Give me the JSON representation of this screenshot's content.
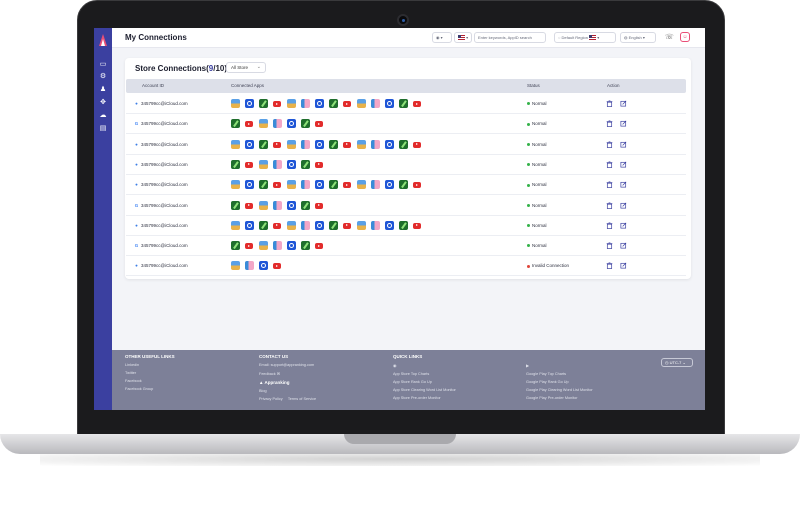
{
  "topbar": {
    "title": "My Connections",
    "search_placeholder": "Enter keywords, AppID search",
    "region": "Default Region",
    "language": "English"
  },
  "sidebar": {
    "icons": [
      "logo-icon",
      "monitor-icon",
      "gear-icon",
      "bell-icon",
      "network-icon",
      "cloud-icon",
      "briefcase-icon"
    ]
  },
  "card": {
    "title_prefix": "Store Connections",
    "title_open": "(",
    "count_used": "9",
    "count_sep": "/10",
    "title_close": ")",
    "store_filter": "All Store",
    "headers": {
      "account": "Account ID",
      "apps": "Connected Apps",
      "status": "Status",
      "action": "Action"
    }
  },
  "rows": [
    {
      "platform": "apple",
      "account": "345799cc@iCloud.com",
      "status": "Normal",
      "status_color": "#35b24a",
      "apps": [
        "sky",
        "circ",
        "grn",
        "yt",
        "sky",
        "bag",
        "circ",
        "grn",
        "yt",
        "sky",
        "bag",
        "circ",
        "grn",
        "yt"
      ]
    },
    {
      "platform": "google",
      "account": "345799cc@iCloud.com",
      "status": "Normal",
      "status_color": "#35b24a",
      "apps": [
        "grn",
        "yt",
        "sky",
        "bag",
        "circ",
        "grn",
        "yt"
      ]
    },
    {
      "platform": "apple",
      "account": "345799cc@iCloud.com",
      "status": "Normal",
      "status_color": "#35b24a",
      "apps": [
        "sky",
        "circ",
        "grn",
        "yt",
        "sky",
        "bag",
        "circ",
        "grn",
        "yt",
        "sky",
        "bag",
        "circ",
        "grn",
        "yt"
      ]
    },
    {
      "platform": "apple",
      "account": "345799cc@iCloud.com",
      "status": "Normal",
      "status_color": "#35b24a",
      "apps": [
        "grn",
        "yt",
        "sky",
        "bag",
        "circ",
        "grn",
        "yt"
      ]
    },
    {
      "platform": "apple",
      "account": "345799cc@iCloud.com",
      "status": "Normal",
      "status_color": "#35b24a",
      "apps": [
        "sky",
        "circ",
        "grn",
        "yt",
        "sky",
        "bag",
        "circ",
        "grn",
        "yt",
        "sky",
        "bag",
        "circ",
        "grn",
        "yt"
      ]
    },
    {
      "platform": "google",
      "account": "345799cc@iCloud.com",
      "status": "Normal",
      "status_color": "#35b24a",
      "apps": [
        "grn",
        "yt",
        "sky",
        "bag",
        "circ",
        "grn",
        "yt"
      ]
    },
    {
      "platform": "apple",
      "account": "345799cc@iCloud.com",
      "status": "Normal",
      "status_color": "#35b24a",
      "apps": [
        "sky",
        "circ",
        "grn",
        "yt",
        "sky",
        "bag",
        "circ",
        "grn",
        "yt",
        "sky",
        "bag",
        "circ",
        "grn",
        "yt"
      ]
    },
    {
      "platform": "google",
      "account": "345799cc@iCloud.com",
      "status": "Normal",
      "status_color": "#35b24a",
      "apps": [
        "grn",
        "yt",
        "sky",
        "bag",
        "circ",
        "grn",
        "yt"
      ]
    },
    {
      "platform": "apple",
      "account": "345799cc@iCloud.com",
      "status": "Invalid Connection",
      "status_color": "#e0463a",
      "apps": [
        "sky",
        "bag",
        "circ",
        "yt"
      ]
    }
  ],
  "footer": {
    "useful_title": "OTHER USEFUL LINKS",
    "useful_links": [
      "Linkedin",
      "Twitter",
      "Facebook",
      "Facebook Group"
    ],
    "contact_title": "CONTACT US",
    "contact_email": "Email: support@appranking.com",
    "contact_feedback": "Feedback",
    "brand": "Appranking",
    "blog": "Blog",
    "privacy": "Privacy Policy",
    "terms": "Terms of Service",
    "quick_title": "QUICK LINKS",
    "app_store_links": [
      "App Store Top Charts",
      "App Store Rank Go Up",
      "App Store Clearing Word List Monitor",
      "App Store Pre-order Monitor"
    ],
    "google_links": [
      "Google Play Top Charts",
      "Google Play Rank Go Up",
      "Google Play Clearing Word List Monitor",
      "Google Play Pre-order Monitor"
    ],
    "timezone": "UTC-7"
  }
}
